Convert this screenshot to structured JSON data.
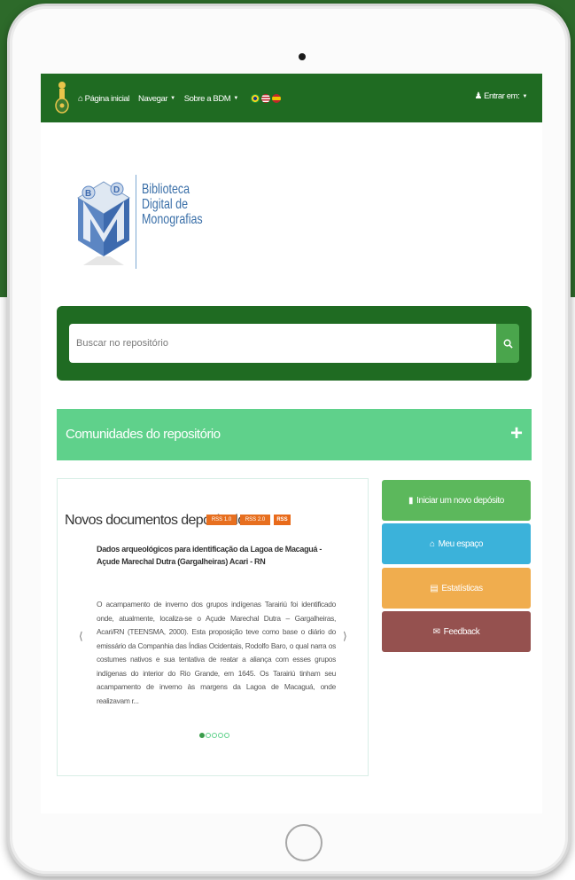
{
  "navbar": {
    "home_label": "Página inicial",
    "navigate_label": "Navegar",
    "about_label": "Sobre a BDM",
    "login_label": "Entrar em:"
  },
  "brand": {
    "logo_text": "Biblioteca Digital de Monografias",
    "line1": "Biblioteca",
    "line2": "Digital de",
    "line3": "Monografias"
  },
  "search": {
    "placeholder": "Buscar no repositório"
  },
  "communities": {
    "label": "Comunidades do repositório"
  },
  "documents": {
    "heading": "Novos documentos depositados",
    "feeds": [
      "RSS 1.0",
      "RSS 2.0",
      "RSS"
    ],
    "title": "Dados arqueológicos para identificação da Lagoa de Macaguá - Açude Marechal Dutra (Gargalheiras) Acari - RN",
    "summary": "O acampamento de inverno dos grupos indígenas Tarairiú foi identificado onde, atualmente, localiza-se o Açude Marechal Dutra – Gargalheiras, Acari/RN (TEENSMA, 2000). Esta proposição teve como base o diário do emissário da Companhia das Índias Ocidentais, Rodolfo Baro, o qual narra os costumes nativos e sua tentativa de reatar a aliança com esses grupos indígenas do interior do Rio Grande, em 1645. Os Tarairiú tinham seu acampamento de inverno às margens da Lagoa de Macaguá, onde realizavam r...",
    "carousel_total": 5,
    "carousel_active": 1
  },
  "actions": {
    "deposit": "Iniciar um novo depósito",
    "my_space": "Meu espaço",
    "stats": "Estatísticas",
    "feedback": "Feedback"
  },
  "colors": {
    "navbar": "#1f6b22",
    "communities": "#5fd18b",
    "deposit": "#5cb85c",
    "my_space": "#3bb2da",
    "stats": "#f0ad4e",
    "feedback": "#95514f"
  }
}
